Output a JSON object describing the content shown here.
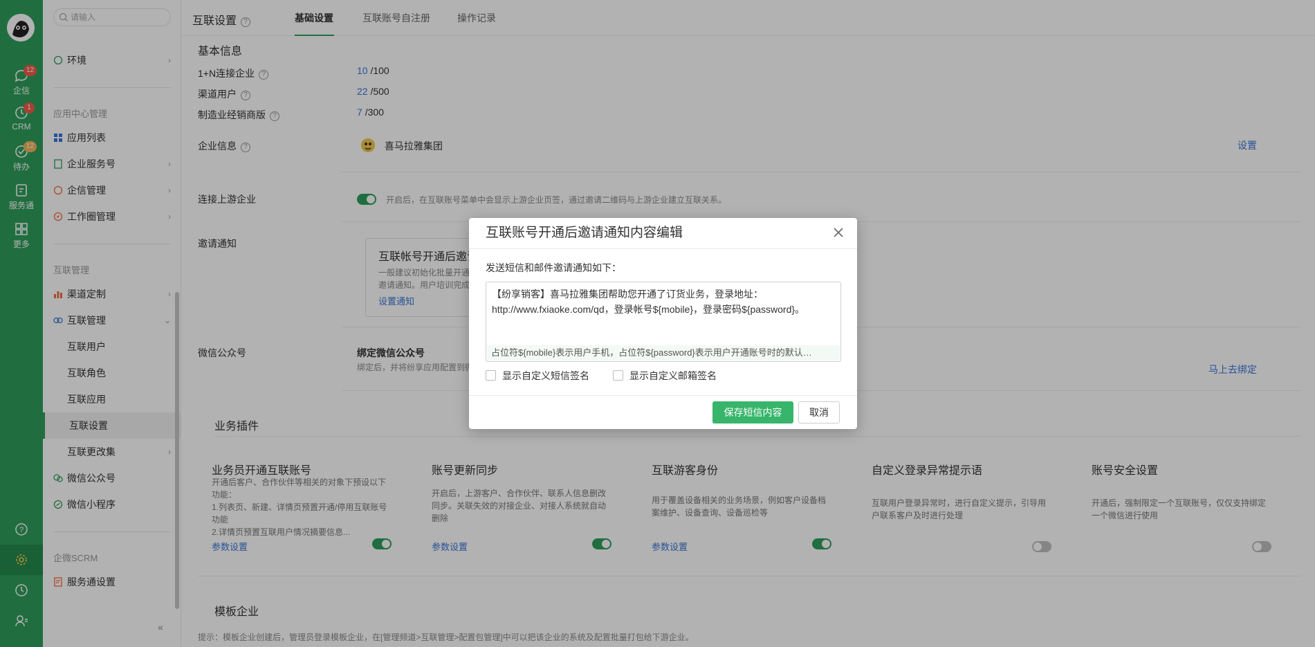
{
  "rail": {
    "items": [
      {
        "label": "企信",
        "badge": "12"
      },
      {
        "label": "CRM",
        "badge": "1"
      },
      {
        "label": "待办",
        "badge": "12"
      },
      {
        "label": "服务通",
        "badge": ""
      },
      {
        "label": "更多",
        "badge": ""
      }
    ]
  },
  "subnav": {
    "search_placeholder": "请输入",
    "env": "环境",
    "group_app": "应用中心管理",
    "app_list": "应用列表",
    "enterprise_service": "企业服务号",
    "qixin_manage": "企信管理",
    "workcircle_manage": "工作圈管理",
    "group_interconnect": "互联管理",
    "channel_custom": "渠道定制",
    "interconnect_manage": "互联管理",
    "children": [
      "互联用户",
      "互联角色",
      "互联应用",
      "互联设置"
    ],
    "interconnect_update": "互联更改集",
    "wechat_official": "微信公众号",
    "wechat_mini": "微信小程序",
    "group_scrm": "企微SCRM",
    "service_settings": "服务通设置"
  },
  "header": {
    "title": "互联设置",
    "tabs": [
      "基础设置",
      "互联账号自注册",
      "操作记录"
    ]
  },
  "basic": {
    "section_title": "基本信息",
    "rows": [
      {
        "label": "1+N连接企业",
        "used": "10",
        "total": "/100"
      },
      {
        "label": "渠道用户",
        "used": "22",
        "total": "/500"
      },
      {
        "label": "制造业经销商版",
        "used": "7",
        "total": "/300"
      }
    ],
    "company_label": "企业信息",
    "company_name": "喜马拉雅集团",
    "company_action": "设置",
    "upstream_label": "连接上游企业",
    "upstream_desc": "开启后，在互联账号菜单中会显示上游企业页签，通过邀请二维码与上游企业建立互联关系。",
    "invite_label": "邀请通知",
    "invite_card_title": "互联帐号开通后邀请通知",
    "invite_card_desc1": "一般建议初始化批量开通",
    "invite_card_desc2": "邀请通知。用户培训完成",
    "invite_card_link": "设置通知",
    "wechat_label": "微信公众号",
    "wechat_bind_title": "绑定微信公众号",
    "wechat_bind_desc": "绑定后，并将纷享应用配置到微",
    "wechat_bind_action": "马上去绑定"
  },
  "plugins": {
    "section_title": "业务插件",
    "items": [
      {
        "title": "业务员开通互联账号",
        "desc": "开通后客户、合作伙伴等相关的对象下预设以下功能：\n1.列表页、新建、详情页预置开通/停用互联账号功能\n2.详情页预置互联用户情况摘要信息...",
        "link": "参数设置",
        "on": true
      },
      {
        "title": "账号更新同步",
        "desc": "开启后，上游客户、合作伙伴、联系人信息删改同步。关联失效的对接企业、对接人系统就自动删除",
        "link": "参数设置",
        "on": true
      },
      {
        "title": "互联游客身份",
        "desc": "用于覆盖设备相关的业务场景，例如客户设备档案维护、设备查询、设备巡检等",
        "link": "参数设置",
        "on": true
      },
      {
        "title": "自定义登录异常提示语",
        "desc": "互联用户登录异常时，进行自定义提示，引导用户联系客户及时进行处理",
        "link": "",
        "on": false
      },
      {
        "title": "账号安全设置",
        "desc": "开通后，强制限定一个互联账号，仅仅支持绑定一个微信进行使用",
        "link": "",
        "on": false
      }
    ]
  },
  "template": {
    "section_title": "模板企业",
    "hint": "提示：模板企业创建后，管理员登录模板企业，在[管理频道>互联管理>配置包管理]中可以把该企业的系统及配置批量打包给下游企业。"
  },
  "dialog": {
    "title": "互联账号开通后邀请通知内容编辑",
    "subtitle": "发送短信和邮件邀请通知如下：",
    "body_line1": "【纷享销客】喜马拉雅集团帮助您开通了订货业务，登录地址：",
    "body_line2": "http://www.fxiaoke.com/qd，登录帐号${mobile}，登录密码${password}。",
    "placeholder_hint": "占位符${mobile}表示用户手机，占位符${password}表示用户开通账号时的默认…",
    "checkbox_sms": "显示自定义短信签名",
    "checkbox_email": "显示自定义邮箱签名",
    "save_label": "保存短信内容",
    "cancel_label": "取消"
  }
}
